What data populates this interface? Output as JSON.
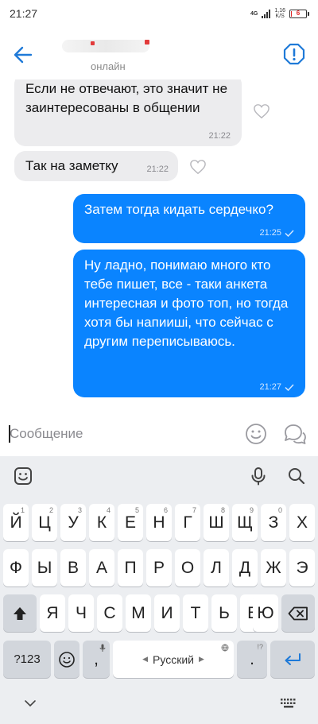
{
  "status_bar": {
    "time": "21:27",
    "network": "4G",
    "speed_value": "1,16",
    "speed_unit": "K/S",
    "battery": "6",
    "battery_level": 0.06,
    "battery_color": "#e02424"
  },
  "header": {
    "status": "онлайн",
    "back_icon": "arrow-left-icon",
    "alert_icon": "alert-octagon-icon",
    "accent": "#1f7ad8"
  },
  "messages": [
    {
      "direction": "in",
      "text": "Если не отвечают, это значит не заинтересованы в общении",
      "time": "21:22"
    },
    {
      "direction": "in",
      "text": "Так на заметку",
      "time": "21:22"
    },
    {
      "direction": "out",
      "text": "Затем тогда кидать сердечко?",
      "time": "21:25"
    },
    {
      "direction": "out",
      "text": "Ну ладно, понимаю много кто тебе пишет, все - таки анкета интересная и фото топ, но тогда хотя бы напиишi, что сейчас с другим переписываюсь.",
      "time": "21:27"
    }
  ],
  "input": {
    "placeholder": "Сообщение"
  },
  "keyboard": {
    "row1": [
      "Й",
      "Ц",
      "У",
      "К",
      "Е",
      "Н",
      "Г",
      "Ш",
      "Щ",
      "З",
      "Х"
    ],
    "row1_hints": [
      "1",
      "2",
      "3",
      "4",
      "5",
      "6",
      "7",
      "8",
      "9",
      "0",
      ""
    ],
    "row2": [
      "Ф",
      "Ы",
      "В",
      "А",
      "П",
      "Р",
      "О",
      "Л",
      "Д",
      "Ж",
      "Э"
    ],
    "row3": [
      "Я",
      "Ч",
      "С",
      "М",
      "И",
      "Т",
      "Ь",
      "Б",
      "Ю"
    ],
    "symbols_key": "?123",
    "comma_key": ",",
    "space_label": "Русский",
    "period_key": ".",
    "period_hint": "!?"
  }
}
